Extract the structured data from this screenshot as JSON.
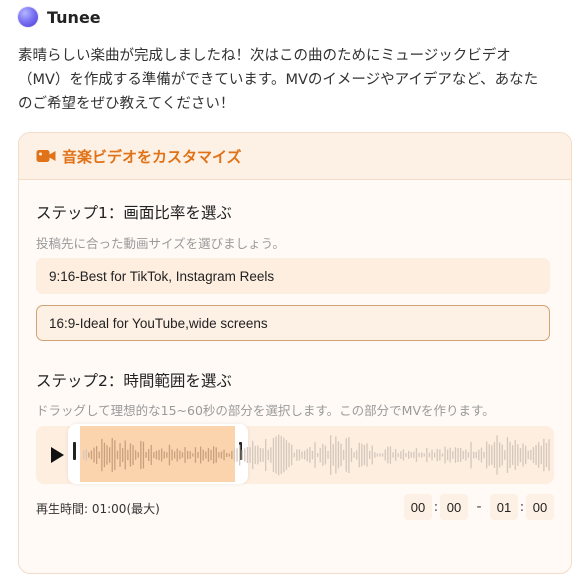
{
  "app": {
    "name": "Tunee"
  },
  "message": {
    "lines": [
      "素晴らしい楽曲が完成しましたね！次はこの曲のためにミュージックビデオ",
      "（MV）を作成する準備ができています。MVのイメージやアイデアなど、あなた",
      "のご希望をぜひ教えてください！"
    ]
  },
  "card": {
    "title": "音楽ビデオをカスタマイズ",
    "icon": "video-camera-icon",
    "accent_color": "#e07218"
  },
  "step1": {
    "title": "ステップ1：画面比率を選ぶ",
    "description": "投稿先に合った動画サイズを選びましょう。",
    "options": [
      {
        "label": "9:16-Best for TikTok, Instagram Reels",
        "selected": false
      },
      {
        "label": "16:9-Ideal for YouTube,wide screens",
        "selected": true
      }
    ]
  },
  "step2": {
    "title": "ステップ2：時間範囲を選ぶ",
    "description": "ドラッグして理想的な15~60秒の部分を選択します。この部分でMVを作ります。",
    "play_icon": "play-icon",
    "playback_label": "再生時間: 01:00(最大)",
    "start": {
      "min": "00",
      "sec": "00"
    },
    "end": {
      "min": "01",
      "sec": "00"
    },
    "separator": ":",
    "range_dash": "-"
  }
}
